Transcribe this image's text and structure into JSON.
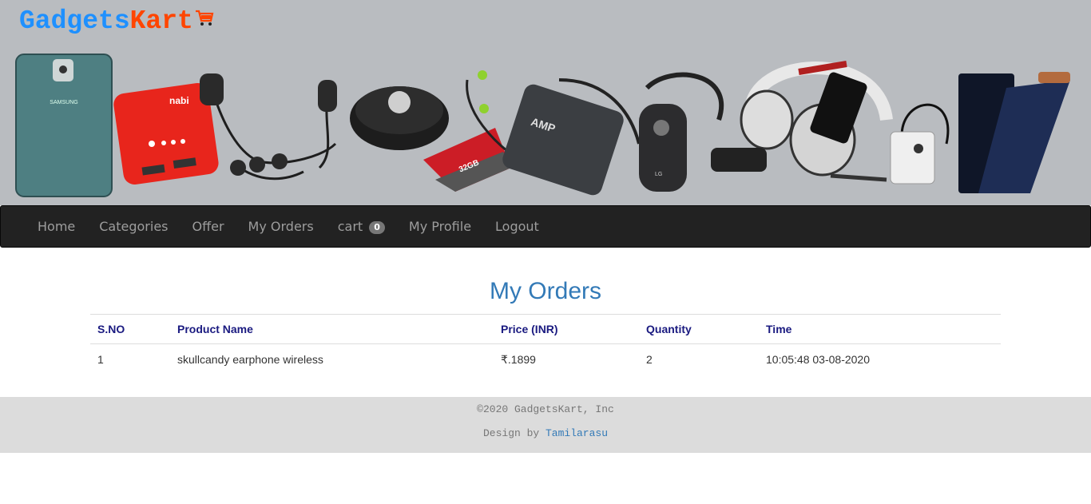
{
  "brand": {
    "part1": "Gadgets",
    "part2": "Kart",
    "cart_icon": "shopping-cart-icon"
  },
  "nav": {
    "home": "Home",
    "categories": "Categories",
    "offer": "Offer",
    "my_orders": "My Orders",
    "cart": "cart",
    "cart_count": "0",
    "my_profile": "My Profile",
    "logout": "Logout"
  },
  "page": {
    "title": "My Orders"
  },
  "orders": {
    "headers": [
      "S.NO",
      "Product Name",
      "Price (INR)",
      "Quantity",
      "Time"
    ],
    "rows": [
      [
        "1",
        "skullcandy earphone wireless",
        "₹.1899",
        "2",
        "10:05:48 03-08-2020"
      ]
    ]
  },
  "footer": {
    "copyright": "©2020 GadgetsKart, Inc",
    "design_prefix": "Design by ",
    "designer": "Tamilarasu"
  },
  "banner": {
    "label_phone": "SAMSUNG",
    "label_powerbank": "nabi",
    "label_sd": "32GB",
    "label_charger": "AMP",
    "label_lg": "LG"
  },
  "colors": {
    "brand_blue": "#1e90ff",
    "brand_orange": "#ff4500",
    "heading_blue": "#337ab7",
    "navbar_bg": "#222222",
    "header_bg": "#b9bcc0"
  }
}
